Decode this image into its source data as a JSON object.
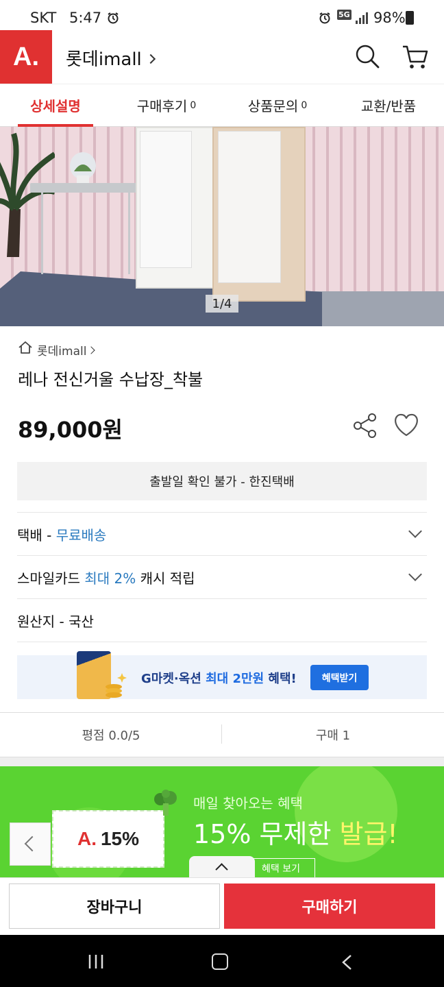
{
  "status_bar": {
    "carrier": "SKT",
    "time": "5:47",
    "network": "5G",
    "battery": "98%"
  },
  "header": {
    "logo": "A.",
    "store_name": "롯데imall"
  },
  "tabs": [
    {
      "label": "상세설명",
      "count": ""
    },
    {
      "label": "구매후기",
      "count": "0"
    },
    {
      "label": "상품문의",
      "count": "0"
    },
    {
      "label": "교환/반품",
      "count": ""
    }
  ],
  "gallery": {
    "indicator": "1/4"
  },
  "product": {
    "store_link": "롯데imall",
    "name": "레나 전신거울 수납장_착불",
    "price": "89,000원"
  },
  "shipping_notice": "출발일 확인 불가 - 한진택배",
  "info_rows": {
    "delivery_prefix": "택배 - ",
    "delivery_value": "무료배송",
    "card_prefix": "스마일카드 ",
    "card_value": "최대 2%",
    "card_suffix": " 캐시 적립",
    "origin": "원산지 - 국산"
  },
  "promo": {
    "text_prefix": "G마켓·옥션 ",
    "text_highlight": "최대 2만원",
    "text_suffix": " 혜택!",
    "button": "혜택받기"
  },
  "stats": {
    "rating": "평점 0.0/5",
    "purchases": "구매 1"
  },
  "event_banner": {
    "coupon_logo": "A.",
    "coupon_value": "15%",
    "line1": "매일 찾아오는 혜택",
    "line2_white": "15% 무제한 ",
    "line2_yellow": "발급!",
    "button": "혜택 보기"
  },
  "bottom_bar": {
    "cart": "장바구니",
    "buy": "구매하기"
  },
  "colors": {
    "brand_red": "#e03131",
    "buy_red": "#e5323b",
    "link_blue": "#2a7abf",
    "promo_blue": "#1f6fe0",
    "event_green": "#5ad332"
  }
}
